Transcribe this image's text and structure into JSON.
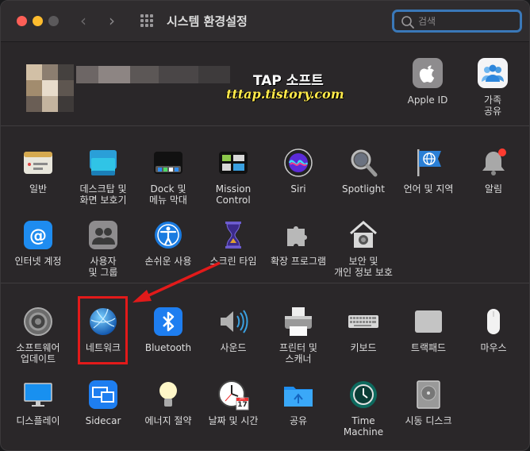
{
  "window": {
    "title": "시스템 환경설정"
  },
  "search": {
    "placeholder": "검색"
  },
  "profile": {
    "watermark_title": "TAP 소프트",
    "watermark_url": "tttap.tistory.com",
    "apple_id_label": "Apple ID",
    "family_label": "가족\n공유"
  },
  "section1": [
    {
      "label": "일반",
      "icon": "general-icon"
    },
    {
      "label": "데스크탑 및\n화면 보호기",
      "icon": "desktop-screensaver-icon"
    },
    {
      "label": "Dock 및\n메뉴 막대",
      "icon": "dock-icon"
    },
    {
      "label": "Mission\nControl",
      "icon": "mission-control-icon"
    },
    {
      "label": "Siri",
      "icon": "siri-icon"
    },
    {
      "label": "Spotlight",
      "icon": "spotlight-icon"
    },
    {
      "label": "언어 및 지역",
      "icon": "language-region-icon"
    },
    {
      "label": "알림",
      "icon": "notifications-icon"
    },
    {
      "label": "인터넷 계정",
      "icon": "internet-accounts-icon"
    },
    {
      "label": "사용자\n및 그룹",
      "icon": "users-groups-icon"
    },
    {
      "label": "손쉬운 사용",
      "icon": "accessibility-icon"
    },
    {
      "label": "스크린 타임",
      "icon": "screen-time-icon"
    },
    {
      "label": "확장 프로그램",
      "icon": "extensions-icon"
    },
    {
      "label": "보안 및\n개인 정보 보호",
      "icon": "security-privacy-icon"
    }
  ],
  "section2": [
    {
      "label": "소프트웨어\n업데이트",
      "icon": "software-update-icon"
    },
    {
      "label": "네트워크",
      "icon": "network-icon"
    },
    {
      "label": "Bluetooth",
      "icon": "bluetooth-icon"
    },
    {
      "label": "사운드",
      "icon": "sound-icon"
    },
    {
      "label": "프린터 및\n스캐너",
      "icon": "printers-scanners-icon"
    },
    {
      "label": "키보드",
      "icon": "keyboard-icon"
    },
    {
      "label": "트랙패드",
      "icon": "trackpad-icon"
    },
    {
      "label": "마우스",
      "icon": "mouse-icon"
    },
    {
      "label": "디스플레이",
      "icon": "displays-icon"
    },
    {
      "label": "Sidecar",
      "icon": "sidecar-icon"
    },
    {
      "label": "에너지 절약",
      "icon": "energy-saver-icon"
    },
    {
      "label": "날짜 및 시간",
      "icon": "date-time-icon"
    },
    {
      "label": "공유",
      "icon": "sharing-icon"
    },
    {
      "label": "Time\nMachine",
      "icon": "time-machine-icon"
    },
    {
      "label": "시동 디스크",
      "icon": "startup-disk-icon"
    }
  ],
  "date_icon": {
    "month": "JUL",
    "day": "17"
  },
  "colors": {
    "accent": "#3a78b8",
    "highlight": "#e21a1a",
    "background": "#2a2729"
  }
}
